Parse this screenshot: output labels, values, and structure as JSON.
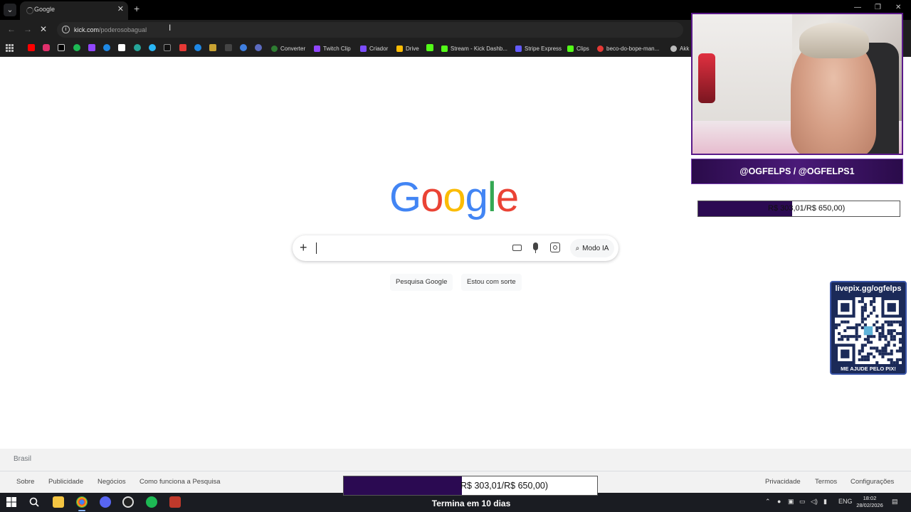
{
  "browser": {
    "tab_title": "Google",
    "url_host": "kick.com",
    "url_path": "/poderosobagual"
  },
  "bookmarks": {
    "items": [
      {
        "label": "Converter",
        "color": "#2e7d32"
      },
      {
        "label": "Twitch Clip",
        "color": "#9146ff"
      },
      {
        "label": "Criador",
        "color": "#7c4dff"
      },
      {
        "label": "Drive",
        "color": "#fbbc04"
      },
      {
        "label": "Stream - Kick Dashb...",
        "color": "#53fc18"
      },
      {
        "label": "Stripe Express",
        "color": "#635bff"
      },
      {
        "label": "Clips",
        "color": "#53fc18"
      },
      {
        "label": "beco-do-bope-man...",
        "color": "#e53935"
      },
      {
        "label": "Akk",
        "color": "#bbbbbb"
      }
    ]
  },
  "google": {
    "logo_letters": [
      "G",
      "o",
      "o",
      "g",
      "l",
      "e"
    ],
    "logo_colors": [
      "#4285F4",
      "#EA4335",
      "#FBBC05",
      "#4285F4",
      "#34A853",
      "#EA4335"
    ],
    "ai_mode_label": "Modo IA",
    "search_button": "Pesquisa Google",
    "lucky_button": "Estou com sorte"
  },
  "footer": {
    "country": "Brasil",
    "left_links": [
      "Sobre",
      "Publicidade",
      "Negócios",
      "Como funciona a Pesquisa"
    ],
    "right_links": [
      "Privacidade",
      "Termos",
      "Configurações"
    ]
  },
  "taskbar": {
    "language": "ENG",
    "time": "18:02",
    "date": "28/02/2026"
  },
  "overlay": {
    "socials": "@OGFELPS / @OGFELPS1",
    "goal_text": "R$ 303,01/R$ 650,00)",
    "goal_progress": 0.466,
    "qr_title": "livepix.gg/ogfelps",
    "qr_footer": "ME AJUDE PELO PIX!",
    "bottom_goal_text": "R$ 303,01/R$ 650,00)",
    "bottom_goal_progress": 0.466,
    "countdown": "Termina em 10 dias"
  }
}
